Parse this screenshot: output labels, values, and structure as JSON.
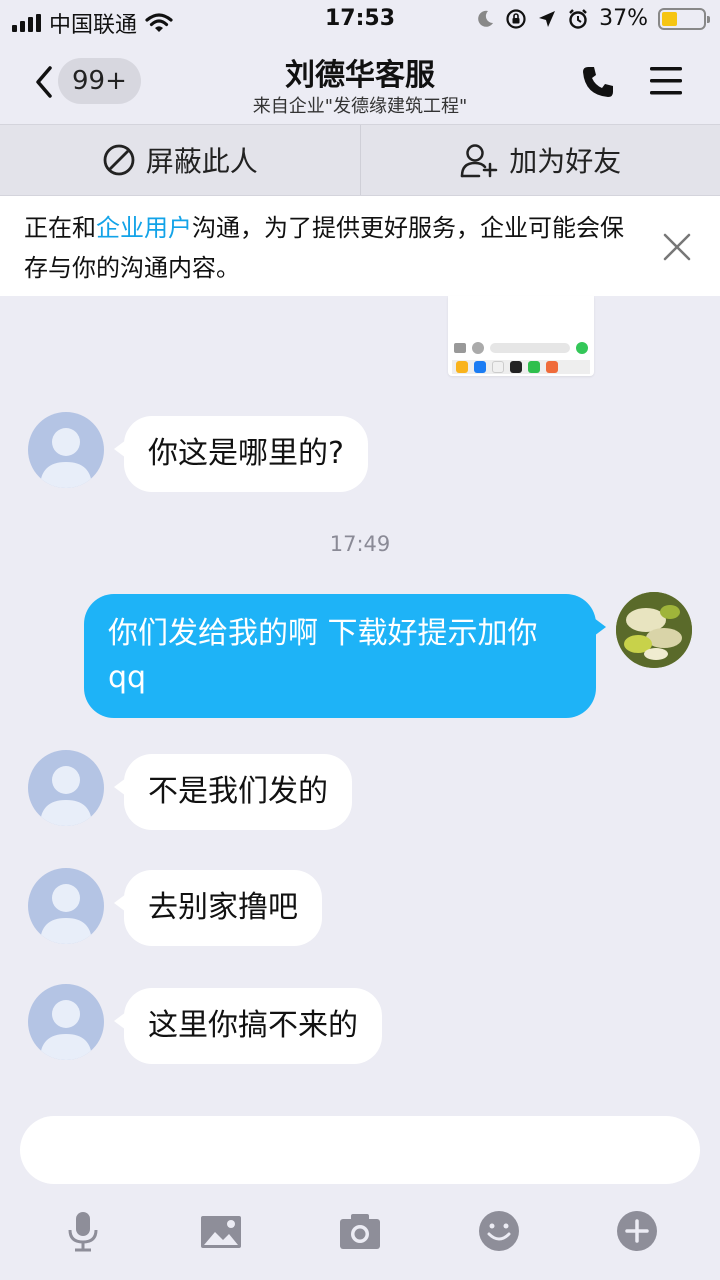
{
  "status": {
    "carrier": "中国联通",
    "time": "17:53",
    "battery": "37%",
    "battery_level": 0.37,
    "battery_color": "#f6c512"
  },
  "nav": {
    "back_badge": "99+",
    "title": "刘德华客服",
    "subtitle": "来自企业\"发德缘建筑工程\""
  },
  "actions": {
    "block_label": "屏蔽此人",
    "add_friend_label": "加为好友"
  },
  "notice": {
    "prefix": "正在和",
    "highlight": "企业用户",
    "suffix": "沟通，为了提供更好服务，企业可能会保存与你的沟通内容。",
    "highlight_color": "#12a3e8"
  },
  "messages": [
    {
      "from": "other",
      "text": "你这是哪里的?"
    },
    {
      "from": "me",
      "text": "你们发给我的啊 下载好提示加你qq"
    },
    {
      "from": "other",
      "text": "不是我们发的"
    },
    {
      "from": "other",
      "text": "去别家撸吧"
    },
    {
      "from": "other",
      "text": "这里你搞不来的"
    }
  ],
  "timestamp": "17:49",
  "colors": {
    "outgoing_bubble": "#1eb3f7",
    "background": "#ececf4"
  },
  "toolbar_icons": [
    "microphone-icon",
    "image-icon",
    "camera-icon",
    "emoji-icon",
    "plus-icon"
  ]
}
